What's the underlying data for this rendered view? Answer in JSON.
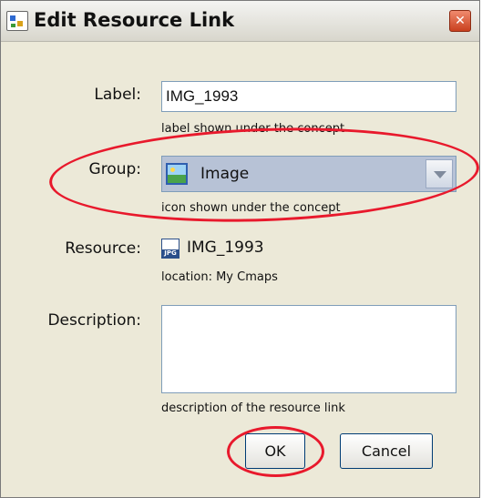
{
  "window": {
    "title": "Edit Resource Link"
  },
  "form": {
    "label": {
      "label": "Label:",
      "value": "IMG_1993",
      "hint": "label shown under the concept"
    },
    "group": {
      "label": "Group:",
      "selected": "Image",
      "hint": "icon shown under the concept"
    },
    "resource": {
      "label": "Resource:",
      "name": "IMG_1993",
      "location": "location: My Cmaps"
    },
    "description": {
      "label": "Description:",
      "value": "",
      "hint": "description of the resource link"
    }
  },
  "buttons": {
    "ok": "OK",
    "cancel": "Cancel"
  },
  "colors": {
    "annotation": "#e8192c",
    "dialog_bg": "#ece9d8",
    "select_bg": "#b7c2d6"
  }
}
